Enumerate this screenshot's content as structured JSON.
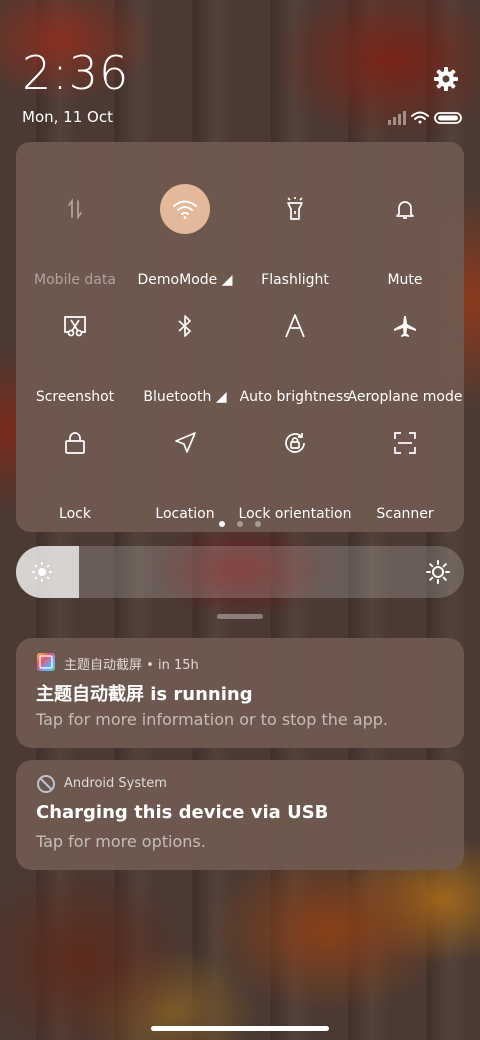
{
  "status": {
    "time": "2:36",
    "date": "Mon, 11 Oct"
  },
  "icons": {
    "settings": "gear-icon",
    "signal": "signal-icon",
    "wifi": "wifi-status-icon",
    "battery": "battery-icon"
  },
  "quick_settings": {
    "tiles": [
      {
        "label": "Mobile data",
        "icon": "mobile-data-icon",
        "state": "disabled"
      },
      {
        "label": "DemoMode ◢",
        "icon": "wifi-icon",
        "state": "on"
      },
      {
        "label": "Flashlight",
        "icon": "flashlight-icon",
        "state": "off"
      },
      {
        "label": "Mute",
        "icon": "bell-icon",
        "state": "off"
      },
      {
        "label": "Screenshot",
        "icon": "screenshot-icon",
        "state": "off"
      },
      {
        "label": "Bluetooth ◢",
        "icon": "bluetooth-icon",
        "state": "off"
      },
      {
        "label": "Auto brightness",
        "icon": "auto-brightness-icon",
        "state": "off"
      },
      {
        "label": "Aeroplane mode",
        "icon": "airplane-icon",
        "state": "off"
      },
      {
        "label": "Lock",
        "icon": "lock-icon",
        "state": "off"
      },
      {
        "label": "Location",
        "icon": "location-icon",
        "state": "off"
      },
      {
        "label": "Lock orientation",
        "icon": "rotation-lock-icon",
        "state": "off"
      },
      {
        "label": "Scanner",
        "icon": "scanner-icon",
        "state": "off"
      }
    ],
    "page_count": 3,
    "current_page": 1,
    "accent": "#e4b89a"
  },
  "brightness": {
    "level": 0.14
  },
  "notifications": [
    {
      "app": "主题自动截屏",
      "time": "• in 15h",
      "title": "主题自动截屏 is running",
      "body": "Tap for more information or to stop the app."
    },
    {
      "app": "Android System",
      "time": "",
      "title": "Charging this device via USB",
      "body": "Tap for more options."
    }
  ]
}
